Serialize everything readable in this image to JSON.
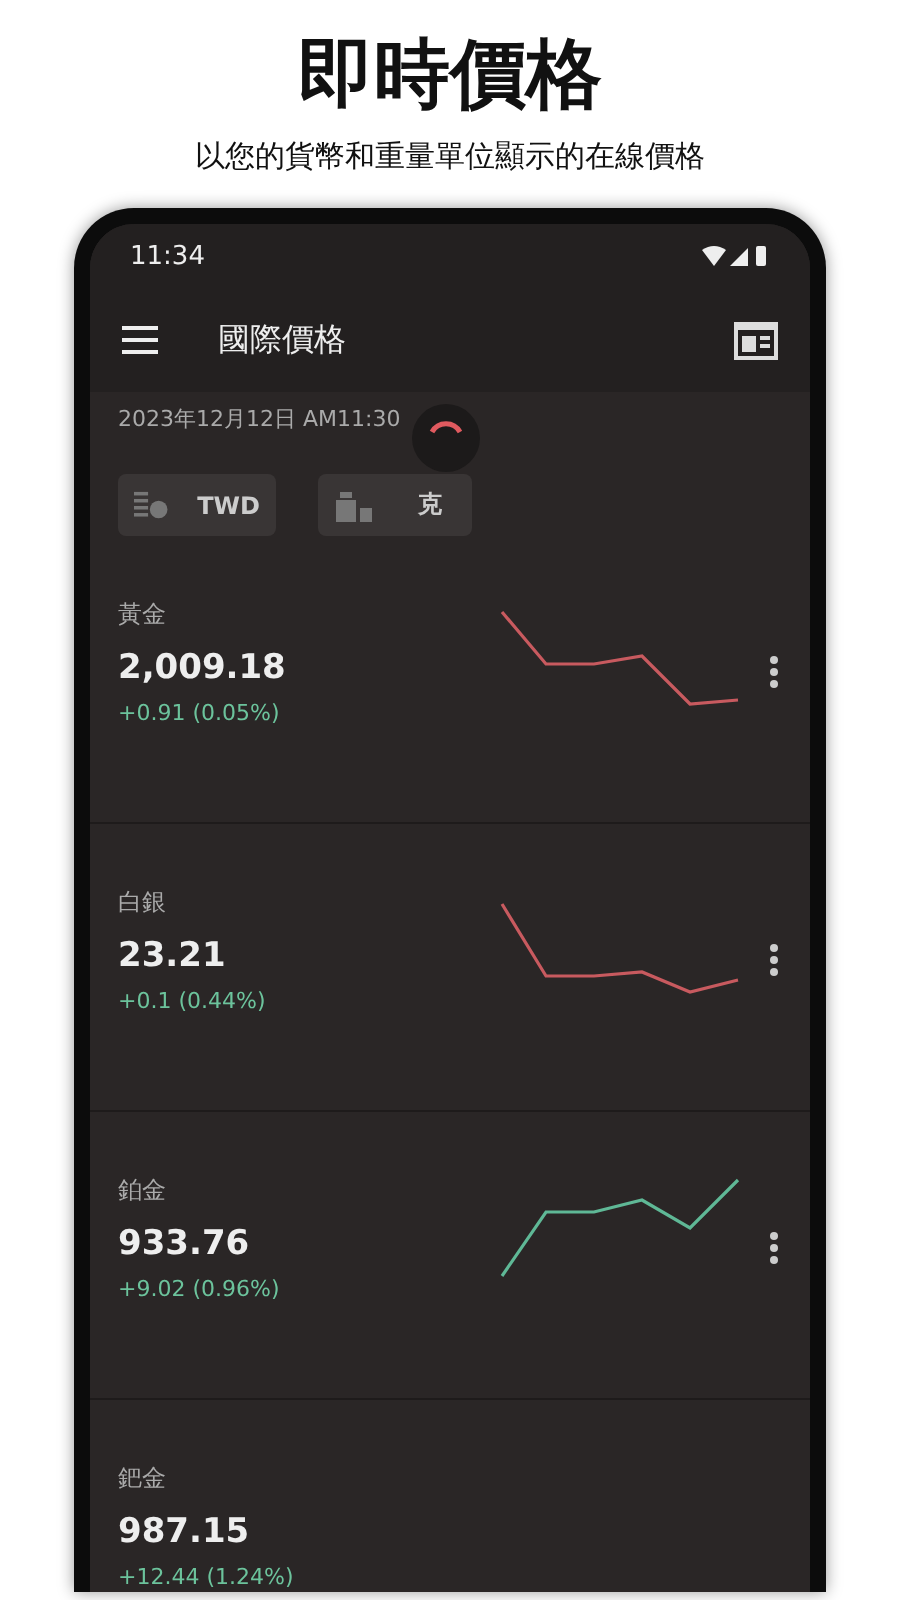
{
  "headline": "即時價格",
  "subheadline": "以您的貨幣和重量單位顯示的在線價格",
  "status_bar": {
    "time": "11:34"
  },
  "app_bar": {
    "title": "國際價格"
  },
  "updated": "2023年12月12日 AM11:30",
  "loading": true,
  "chips": [
    {
      "kind": "currency",
      "label": "TWD"
    },
    {
      "kind": "weight",
      "label": "克"
    }
  ],
  "items": [
    {
      "name": "黃金",
      "price": "2,009.18",
      "change": "+0.91 (0.05%)",
      "kind": "down"
    },
    {
      "name": "白銀",
      "price": "23.21",
      "change": "+0.1 (0.44%)",
      "kind": "down"
    },
    {
      "name": "鉑金",
      "price": "933.76",
      "change": "+9.02 (0.96%)",
      "kind": "up"
    },
    {
      "name": "鈀金",
      "price": "987.15",
      "change": "+12.44 (1.24%)",
      "kind": "plain"
    }
  ]
}
